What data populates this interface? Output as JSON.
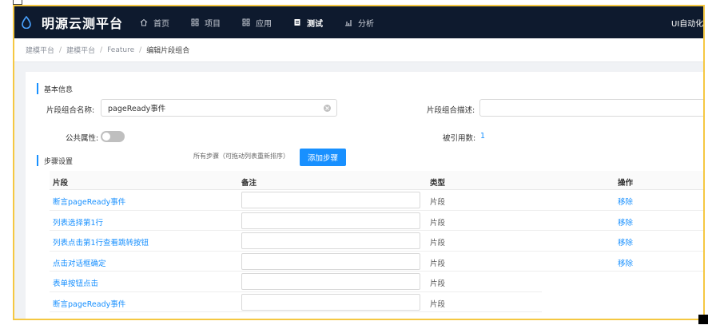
{
  "topbar": {
    "brand": "明源云测平台",
    "nav": [
      {
        "label": "首页",
        "icon": "home-icon"
      },
      {
        "label": "项目",
        "icon": "grid-icon"
      },
      {
        "label": "应用",
        "icon": "grid-icon"
      },
      {
        "label": "测试",
        "icon": "document-icon",
        "active": true
      },
      {
        "label": "分析",
        "icon": "bar-chart-icon"
      }
    ],
    "right_text": "UI自动化",
    "colors": {
      "bg": "#0e1a2e",
      "accent": "#1890ff"
    }
  },
  "breadcrumb": [
    "建模平台",
    "建模平台",
    "Feature",
    "编辑片段组合"
  ],
  "basic_info": {
    "title": "基本信息",
    "name_label": "片段组合名称:",
    "name_value": "pageReady事件",
    "desc_label": "片段组合描述:",
    "desc_value": "",
    "public_label": "公共属性:",
    "public_on": false,
    "ref_label": "被引用数:",
    "ref_count": "1"
  },
  "steps": {
    "title": "步骤设置",
    "hint": "所有步骤（可拖动列表重新排序）",
    "add_button": "添加步骤",
    "columns": [
      "片段",
      "备注",
      "类型",
      "操作"
    ],
    "rows": [
      {
        "name": "断言pageReady事件",
        "remark": "",
        "type": "片段",
        "op": "移除"
      },
      {
        "name": "列表选择第1行",
        "remark": "",
        "type": "片段",
        "op": "移除"
      },
      {
        "name": "列表点击第1行查看跳转按钮",
        "remark": "",
        "type": "片段",
        "op": "移除"
      },
      {
        "name": "点击对话框确定",
        "remark": "",
        "type": "片段",
        "op": "移除"
      },
      {
        "name": "表单按钮点击",
        "remark": "",
        "type": "片段",
        "op": ""
      },
      {
        "name": "断言pageReady事件",
        "remark": "",
        "type": "片段",
        "op": ""
      }
    ]
  }
}
